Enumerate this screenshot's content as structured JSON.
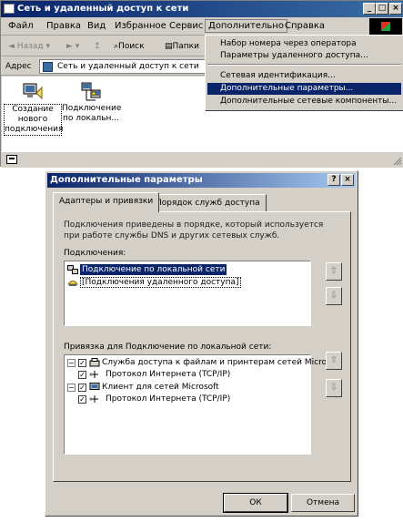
{
  "explorer": {
    "title": "Сеть и удаленный доступ к сети",
    "menu": [
      "Файл",
      "Правка",
      "Вид",
      "Избранное",
      "Сервис",
      "Дополнительно",
      "Справка"
    ],
    "toolbar": {
      "back": "Назад",
      "search": "Поиск",
      "folders": "Папки"
    },
    "address_label": "Адрес",
    "address_value": "Сеть и удаленный доступ к сети",
    "items": [
      {
        "label": "Создание нового подключения"
      },
      {
        "label": "Подключение по локальн..."
      }
    ],
    "dropdown": {
      "items": [
        "Набор номера через оператора",
        "Параметры удаленного доступа...",
        "Сетевая идентификация...",
        "Дополнительные параметры...",
        "Дополнительные сетевые компоненты..."
      ],
      "highlighted_index": 3
    }
  },
  "dialog": {
    "title": "Дополнительные параметры",
    "tabs": [
      "Адаптеры и привязки",
      "Порядок служб доступа"
    ],
    "description": "Подключения приведены в порядке, который используется при работе службы DNS и других сетевых служб.",
    "connections_label": "Подключения:",
    "connections": [
      "Подключение по локальной сети",
      "[Подключения удаленного доступа]"
    ],
    "bindings_label": "Привязка для Подключение по локальной сети:",
    "bindings": [
      {
        "label": "Служба доступа к файлам и принтерам сетей Microsoft",
        "level": 0,
        "checked": true
      },
      {
        "label": "Протокол Интернета (TCP/IP)",
        "level": 1,
        "checked": true
      },
      {
        "label": "Клиент для сетей Microsoft",
        "level": 0,
        "checked": true
      },
      {
        "label": "Протокол Интернета (TCP/IP)",
        "level": 1,
        "checked": true
      }
    ],
    "ok_label": "ОК",
    "cancel_label": "Отмена",
    "help_glyph": "?",
    "close_glyph": "×"
  },
  "colors": {
    "titlebar": "#0a246a",
    "face": "#d4d0c8",
    "highlight": "#0a246a"
  }
}
